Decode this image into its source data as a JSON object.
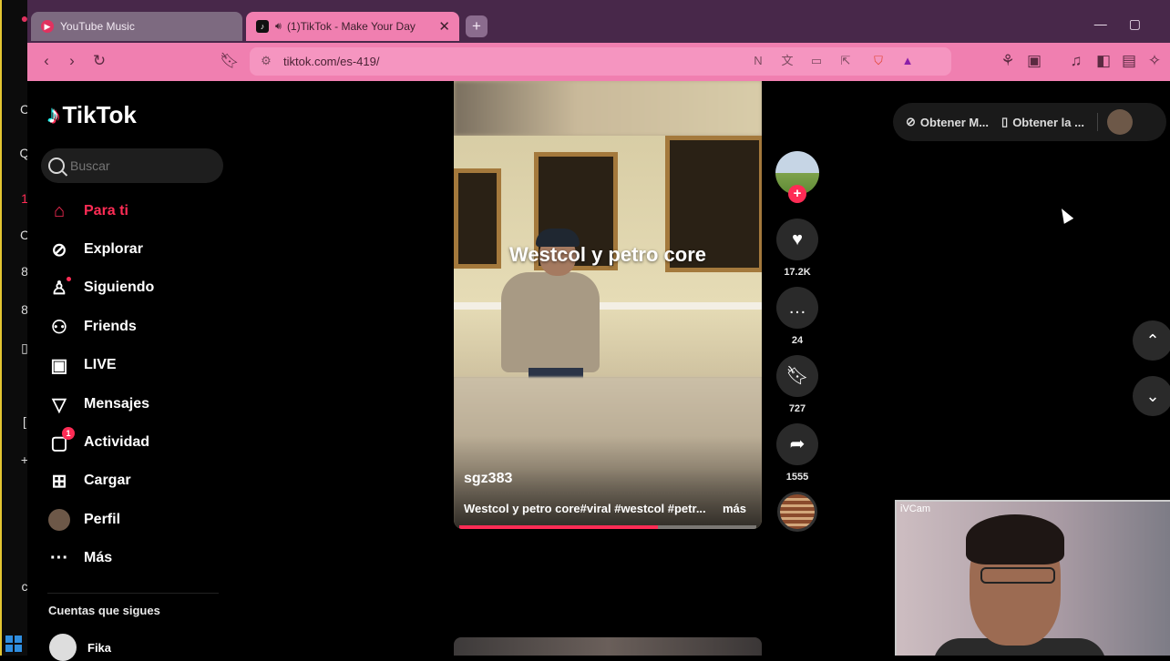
{
  "browser": {
    "tabs": [
      {
        "label": "YouTube Music"
      },
      {
        "label": "(1)TikTok - Make Your Day"
      }
    ],
    "url": "tiktok.com/es-419/"
  },
  "app": {
    "logo": "TikTok"
  },
  "search": {
    "placeholder": "Buscar"
  },
  "nav": [
    {
      "label": "Para ti",
      "icon": "home-icon",
      "active": true
    },
    {
      "label": "Explorar",
      "icon": "compass-icon"
    },
    {
      "label": "Siguiendo",
      "icon": "following-icon"
    },
    {
      "label": "Friends",
      "icon": "friends-icon"
    },
    {
      "label": "LIVE",
      "icon": "live-icon"
    },
    {
      "label": "Mensajes",
      "icon": "messages-icon"
    },
    {
      "label": "Actividad",
      "icon": "activity-icon",
      "badge": "1"
    },
    {
      "label": "Cargar",
      "icon": "upload-icon"
    },
    {
      "label": "Perfil",
      "icon": "profile-icon"
    },
    {
      "label": "Más",
      "icon": "more-icon"
    }
  ],
  "following": {
    "title": "Cuentas que sigues",
    "accounts": [
      {
        "name": "Fika"
      }
    ]
  },
  "video": {
    "overlay_text": "Westcol y petro core",
    "author": "sgz383",
    "caption": "Westcol y petro core#viral #westcol #petr...",
    "more": "más",
    "progress": 0.67
  },
  "actions": {
    "likes": "17.2K",
    "comments": "24",
    "saves": "727",
    "shares": "1555"
  },
  "topbar": {
    "get_coins": "Obtener M...",
    "get_app": "Obtener la ..."
  },
  "webcam": {
    "label": "iVCam"
  },
  "colors": {
    "accent": "#fe2c55",
    "browser_toolbar": "#f07fb0"
  }
}
